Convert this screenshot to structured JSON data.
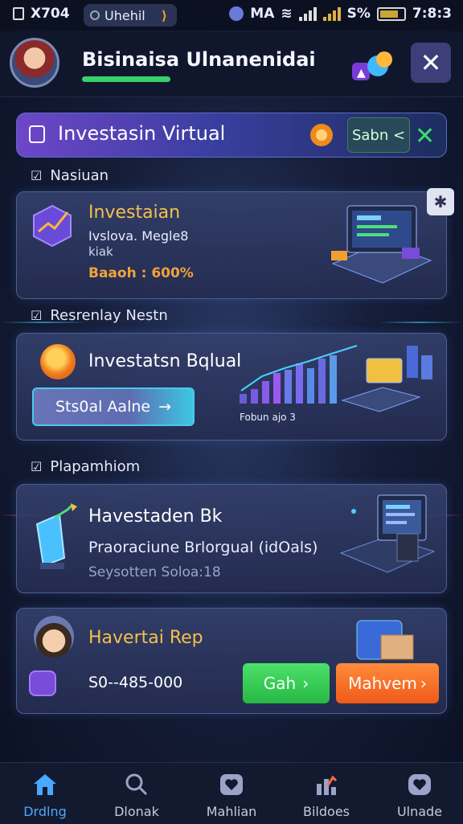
{
  "status_bar": {
    "left_text": "Ⅹ704",
    "pill_text": "Uhehil",
    "carrier": "MA",
    "battery_percent": "S%",
    "time": "7:8:3"
  },
  "header": {
    "title": "Bisinaisa Ulnanenidai"
  },
  "virtual_bar": {
    "title": "Investasin Virtual",
    "button_label": "Sabn <"
  },
  "section1": {
    "label": "Nasiuan"
  },
  "card1": {
    "title": "Investaian",
    "line1": "Ivslova. Megle8",
    "line2": "kiak",
    "stat": "Baaoh : 600%"
  },
  "section2": {
    "label": "Resrenlay Nestn"
  },
  "card2": {
    "title": "Investatsn Bqlual",
    "button_label": "Sts0al  Aalne",
    "caption": "Fobun ajo 3"
  },
  "section3": {
    "label": "Plapamhiom"
  },
  "card3": {
    "title": "Havestaden Bk",
    "subtitle": "Praoraciune Brlorgual (idOals)",
    "note": "Seysotten Soloa:18"
  },
  "card4": {
    "title": "Havertai Rep",
    "value": "S0--485-000",
    "gain_label": "Gah",
    "more_label": "Mahvem"
  },
  "bottom_nav": [
    {
      "label": "Drdlng",
      "icon": "home-icon"
    },
    {
      "label": "Dlonak",
      "icon": "search-icon"
    },
    {
      "label": "Mahlian",
      "icon": "heart-icon"
    },
    {
      "label": "Bildoes",
      "icon": "chart-icon"
    },
    {
      "label": "Ulnade",
      "icon": "heart-icon"
    }
  ],
  "colors": {
    "accent_gold": "#f5c04a",
    "accent_green": "#36d16a",
    "accent_orange": "#f05a1a",
    "nav_active": "#4aa8ff"
  }
}
